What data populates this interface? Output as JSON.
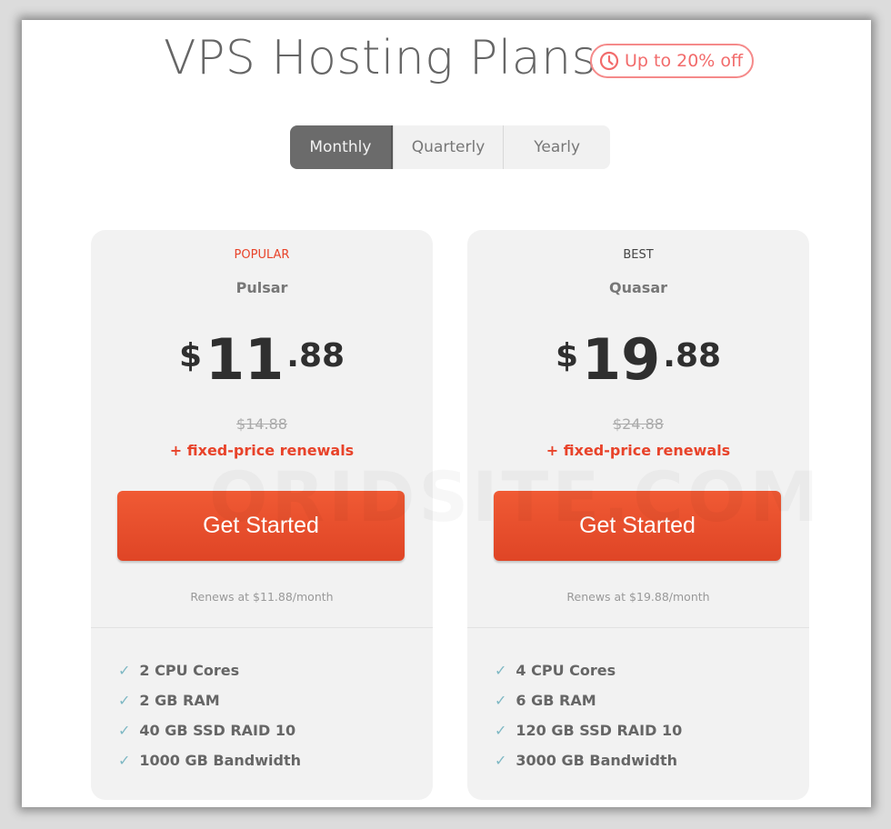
{
  "header": {
    "title": "VPS Hosting Plans",
    "badge": "Up to 20% off",
    "badge_icon": "clock-icon"
  },
  "billing_toggle": {
    "options": [
      "Monthly",
      "Quarterly",
      "Yearly"
    ],
    "selected": "Monthly"
  },
  "plans": [
    {
      "tag": "POPULAR",
      "tag_color": "#e8432a",
      "name": "Pulsar",
      "currency": "$",
      "price_whole": "11",
      "price_cents": ".88",
      "old_price": "$14.88",
      "renewal_note": "+ fixed-price renewals",
      "button": "Get Started",
      "renews": "Renews at $11.88/month",
      "features": [
        "2 CPU Cores",
        "2 GB RAM",
        "40 GB SSD RAID 10",
        "1000 GB Bandwidth"
      ]
    },
    {
      "tag": "BEST",
      "tag_color": "#444444",
      "name": "Quasar",
      "currency": "$",
      "price_whole": "19",
      "price_cents": ".88",
      "old_price": "$24.88",
      "renewal_note": "+ fixed-price renewals",
      "button": "Get Started",
      "renews": "Renews at $19.88/month",
      "features": [
        "4 CPU Cores",
        "6 GB RAM",
        "120 GB SSD RAID 10",
        "3000 GB Bandwidth"
      ]
    }
  ],
  "watermark": "ORIDSITE.COM",
  "colors": {
    "accent": "#e8432a",
    "badge": "#f26b6b",
    "check": "#7fb8c4"
  }
}
